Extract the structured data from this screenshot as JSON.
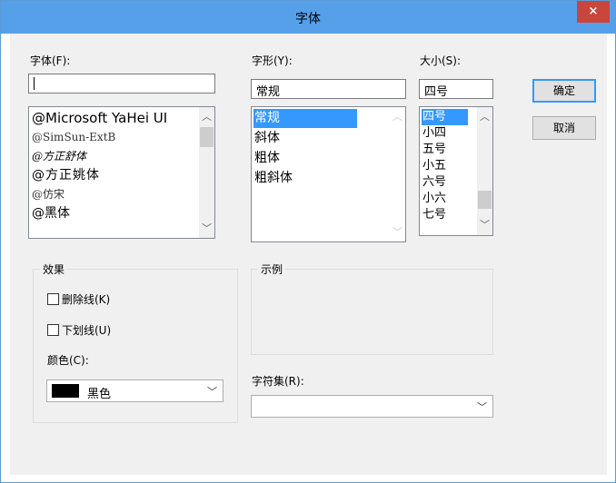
{
  "window": {
    "title": "字体",
    "close_symbol": "×"
  },
  "font": {
    "label": "字体(F):",
    "value": "",
    "items": [
      "@Microsoft YaHei UI",
      "@SimSun-ExtB",
      "@方正舒体",
      "@方正姚体",
      "@仿宋",
      "@黑体"
    ]
  },
  "style": {
    "label": "字形(Y):",
    "value": "常规",
    "items": [
      "常规",
      "斜体",
      "粗体",
      "粗斜体"
    ],
    "selected": "常规"
  },
  "size": {
    "label": "大小(S):",
    "value": "四号",
    "items": [
      "四号",
      "小四",
      "五号",
      "小五",
      "六号",
      "小六",
      "七号"
    ],
    "selected": "四号"
  },
  "buttons": {
    "ok": "确定",
    "cancel": "取消"
  },
  "effects": {
    "label": "效果",
    "strikeout": {
      "label": "删除线(K)",
      "checked": false
    },
    "underline": {
      "label": "下划线(U)",
      "checked": false
    },
    "color_label": "颜色(C):",
    "color_value": "黑色",
    "color_hex": "#000000"
  },
  "sample": {
    "label": "示例"
  },
  "charset": {
    "label": "字符集(R):",
    "value": ""
  },
  "icons": {
    "up": "up-arrow-icon",
    "down": "down-arrow-icon",
    "dropdown": "chevron-down-icon"
  }
}
